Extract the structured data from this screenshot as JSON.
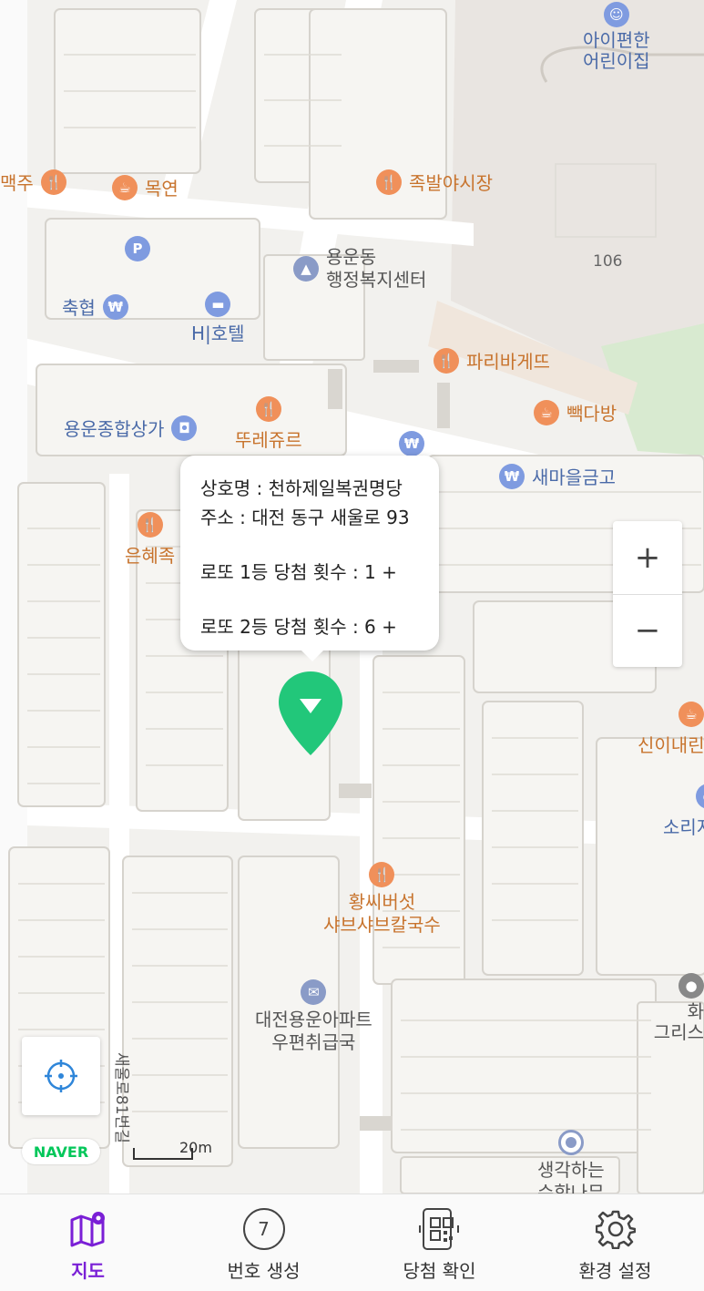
{
  "map": {
    "pois": [
      {
        "id": "maekju",
        "label": "맥주",
        "type": "food",
        "icon": "fork-knife-icon"
      },
      {
        "id": "mokyeon",
        "label": "목연",
        "type": "food",
        "icon": "cup-icon"
      },
      {
        "id": "jokbal",
        "label": "족발야시장",
        "type": "food",
        "icon": "fork-knife-icon"
      },
      {
        "id": "kids",
        "label1": "아이편한",
        "label2": "어린이집",
        "type": "blue",
        "icon": "daycare-icon"
      },
      {
        "id": "parking",
        "label": "P",
        "type": "blue",
        "icon": "parking-icon"
      },
      {
        "id": "office",
        "label1": "용운동",
        "label2": "행정복지센터",
        "type": "gov",
        "icon": "government-icon"
      },
      {
        "id": "nh",
        "label": "축협",
        "type": "blue",
        "icon": "bank-icon"
      },
      {
        "id": "hotel",
        "label": "H|호텔",
        "type": "blue",
        "icon": "hotel-icon"
      },
      {
        "id": "paris",
        "label": "파리바게뜨",
        "type": "food",
        "icon": "fork-knife-icon"
      },
      {
        "id": "ppak",
        "label": "빽다방",
        "type": "food",
        "icon": "cup-icon"
      },
      {
        "id": "mall",
        "label": "용운종합상가",
        "type": "blue",
        "icon": "shopping-icon"
      },
      {
        "id": "tous",
        "label": "뚜레쥬르",
        "type": "food",
        "icon": "fork-knife-icon"
      },
      {
        "id": "saemaeul",
        "label": "새마을금고",
        "type": "blue",
        "icon": "bank-icon"
      },
      {
        "id": "eunhye",
        "label": "은혜족",
        "type": "food",
        "icon": "fork-knife-icon"
      },
      {
        "id": "sini",
        "label": "신이내린",
        "type": "food",
        "icon": "cup-icon"
      },
      {
        "id": "sori",
        "label": "소리지",
        "type": "blue",
        "icon": "place-icon"
      },
      {
        "id": "hwangssi",
        "label1": "황씨버섯",
        "label2": "샤브샤브칼국수",
        "type": "food",
        "icon": "fork-knife-icon"
      },
      {
        "id": "post",
        "label1": "대전용운아파트",
        "label2": "우편취급국",
        "type": "gov",
        "icon": "post-icon"
      },
      {
        "id": "christ",
        "label1": "화",
        "label2": "그리스",
        "type": "gov",
        "icon": "place-icon"
      },
      {
        "id": "think",
        "label1": "생각하는",
        "label2": "수학나무",
        "type": "gov",
        "icon": "place-icon"
      }
    ],
    "building_number": "106",
    "road_label": "새울로81번길",
    "scale_label": "20m",
    "brand": "NAVER"
  },
  "info_window": {
    "name_line": "상호명 : 천하제일복권명당",
    "address_line": "주소 : 대전 동구 새울로 93",
    "first_prize_line": "로또 1등 당첨 횟수 :  1 +",
    "second_prize_line": "로또 2등 당첨 횟수 :  6 +"
  },
  "zoom": {
    "plus": "+",
    "minus": "−"
  },
  "nav": {
    "tabs": [
      {
        "label": "지도",
        "icon": "map-pin-icon",
        "active": true
      },
      {
        "label": "번호 생성",
        "icon": "ball-seven-icon",
        "ball": "7"
      },
      {
        "label": "당첨 확인",
        "icon": "qr-scan-icon"
      },
      {
        "label": "환경 설정",
        "icon": "gear-icon"
      }
    ]
  },
  "colors": {
    "accent": "#7a1fd6",
    "marker": "#22c77a",
    "naver": "#03c75a"
  }
}
